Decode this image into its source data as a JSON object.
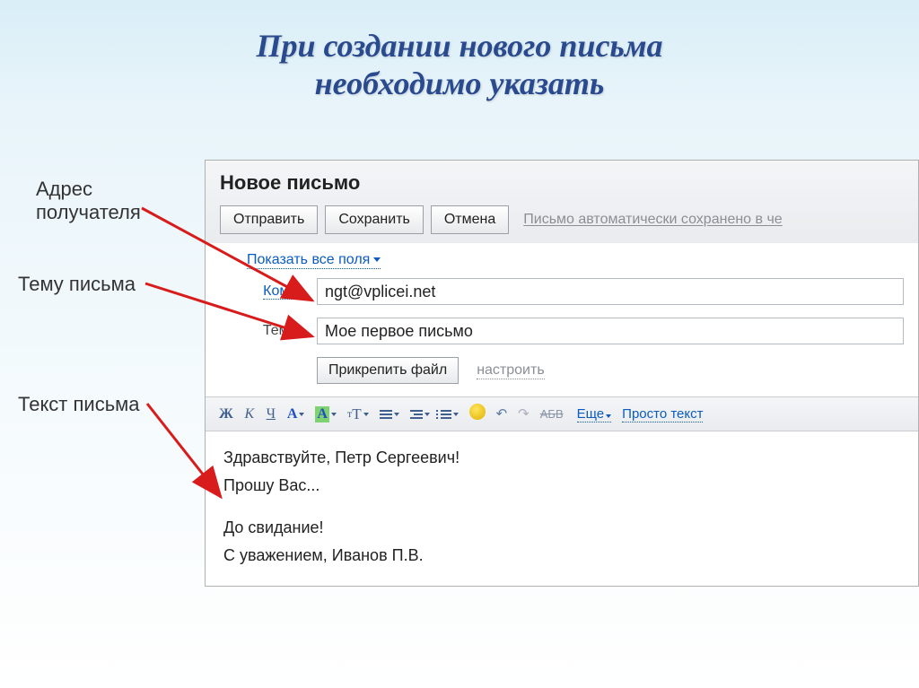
{
  "slide": {
    "title_line1": "При создании нового письма",
    "title_line2": "необходимо указать"
  },
  "labels": {
    "address": "Адрес получателя",
    "subject": "Тему письма",
    "body": "Текст письма"
  },
  "email": {
    "window_title": "Новое письмо",
    "toolbar": {
      "send": "Отправить",
      "save": "Сохранить",
      "cancel": "Отмена",
      "autosave": "Письмо автоматически сохранено в че"
    },
    "show_all": "Показать все поля",
    "to_label": "Кому:",
    "to_value": "ngt@vplicei.net",
    "subject_label": "Тема:",
    "subject_value": "Мое первое письмо",
    "attach": "Прикрепить файл",
    "settings": "настроить",
    "format_more": "Еще",
    "format_plain": "Просто текст",
    "format_strike": "АБВ",
    "bold": "Ж",
    "italic": "К",
    "underline": "Ч",
    "letter_a": "А",
    "body_lines": {
      "l1": "Здравствуйте, Петр Сергеевич!",
      "l2": "Прошу Вас...",
      "l3": "До свидание!",
      "l4": "С уважением, Иванов П.В."
    }
  }
}
